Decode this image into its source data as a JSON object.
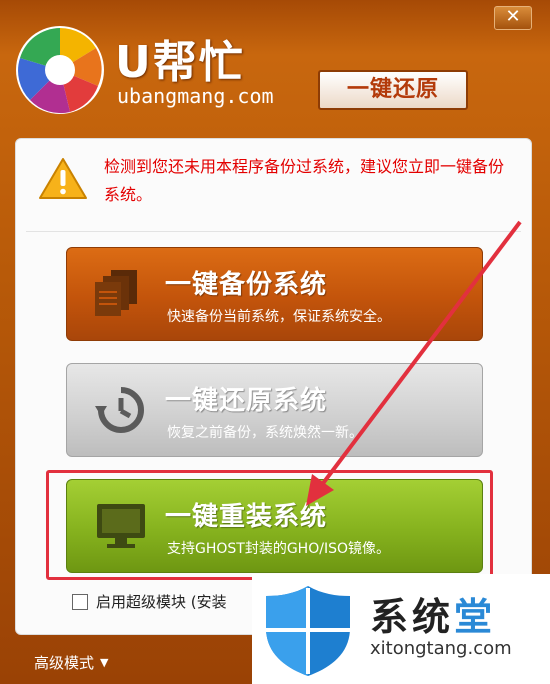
{
  "window": {
    "close_label": "✕"
  },
  "header": {
    "brand_name": "U帮忙",
    "brand_url": "ubangmang.com",
    "restore_button": "一键还原"
  },
  "warning": {
    "icon": "warning-icon",
    "text": "检测到您还未用本程序备份过系统，建议您立即一键备份系统。"
  },
  "actions": [
    {
      "title": "一键备份系统",
      "subtitle": "快速备份当前系统，保证系统安全。",
      "icon": "documents-icon",
      "color": "#c3540b"
    },
    {
      "title": "一键还原系统",
      "subtitle": "恢复之前备份，系统焕然一新。",
      "icon": "history-icon",
      "color": "#cfcfcf"
    },
    {
      "title": "一键重装系统",
      "subtitle": "支持GHOST封装的GHO/ISO镜像。",
      "icon": "monitor-icon",
      "color": "#86b21e"
    }
  ],
  "options": {
    "super_mode_label": "启用超级模块 (安装"
  },
  "footer": {
    "advanced_mode": "高级模式",
    "advanced_caret": "▼"
  },
  "watermark": {
    "title_main": "系统",
    "title_accent": "堂",
    "url": "xitongtang.com"
  },
  "colors": {
    "window_bg": "#b85a09",
    "warning_text": "#e30000",
    "highlight_box": "#e2303e",
    "arrow": "#e2303e"
  }
}
